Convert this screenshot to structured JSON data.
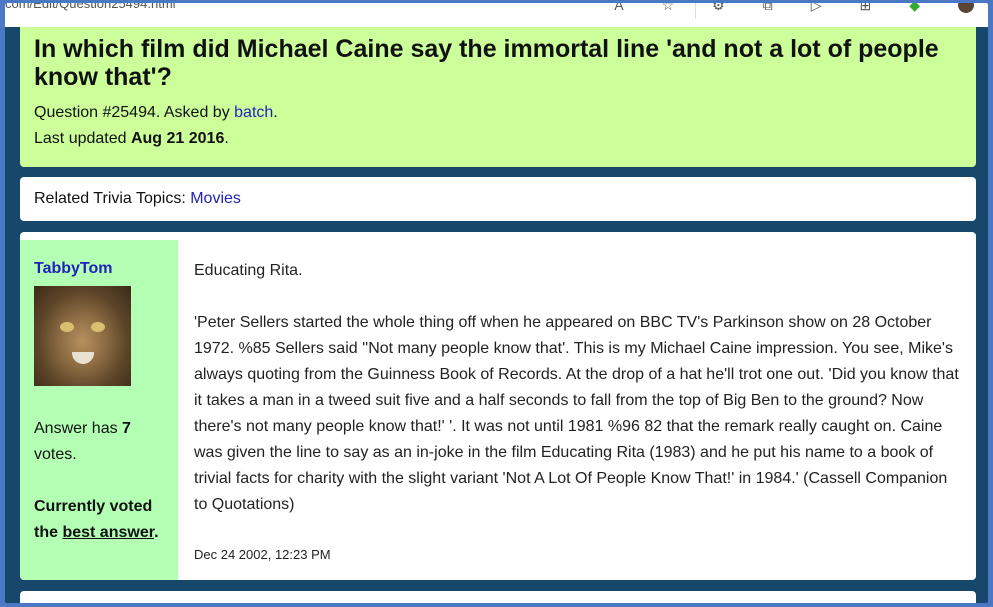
{
  "browser": {
    "url": "com/Edit/Question25494.html",
    "icons": [
      "reader-icon",
      "star-icon",
      "extensions-icon",
      "split-icon",
      "favorites-icon",
      "collections-icon",
      "copilot-icon",
      "profile-icon"
    ]
  },
  "question": {
    "title": "In which film did Michael Caine say the immortal line 'and not a lot of people know that'?",
    "number_prefix": "Question #25494. Asked by ",
    "asker": "batch",
    "number_suffix": ".",
    "updated_prefix": "Last updated ",
    "updated_date": "Aug 21 2016",
    "updated_suffix": "."
  },
  "topics": {
    "label": "Related Trivia Topics: ",
    "link": "Movies"
  },
  "answer": {
    "author": "TabbyTom",
    "votes_prefix": "Answer has ",
    "votes_count": "7",
    "votes_suffix": "votes.",
    "voted_prefix": "Currently voted the ",
    "voted_link": "best answer",
    "voted_suffix": ".",
    "short": "Educating Rita.",
    "body": "'Peter Sellers started the whole thing off when he appeared on BBC TV's Parkinson show on 28 October 1972. %85 Sellers said ''Not many people know that'. This is my Michael Caine impression. You see, Mike's always quoting from the Guinness Book of Records. At the drop of a hat he'll trot one out. 'Did you know that it takes a man in a tweed suit five and a half seconds to fall from the top of Big Ben to the ground? Now there's not many people know that!' '. It was not until 1981 %96 82 that the remark really caught on. Caine was given the line to say as an in-joke in the film Educating Rita (1983) and he put his name to a book of trivial facts for charity with the slight variant 'Not A Lot Of People Know That!' in 1984.' (Cassell Companion to Quotations)",
    "date": "Dec 24 2002, 12:23 PM"
  },
  "colors": {
    "question_bg": "#ccff99",
    "side_bg": "#b3ffb3",
    "link": "#2222bb",
    "page_bg": "#17486b"
  }
}
